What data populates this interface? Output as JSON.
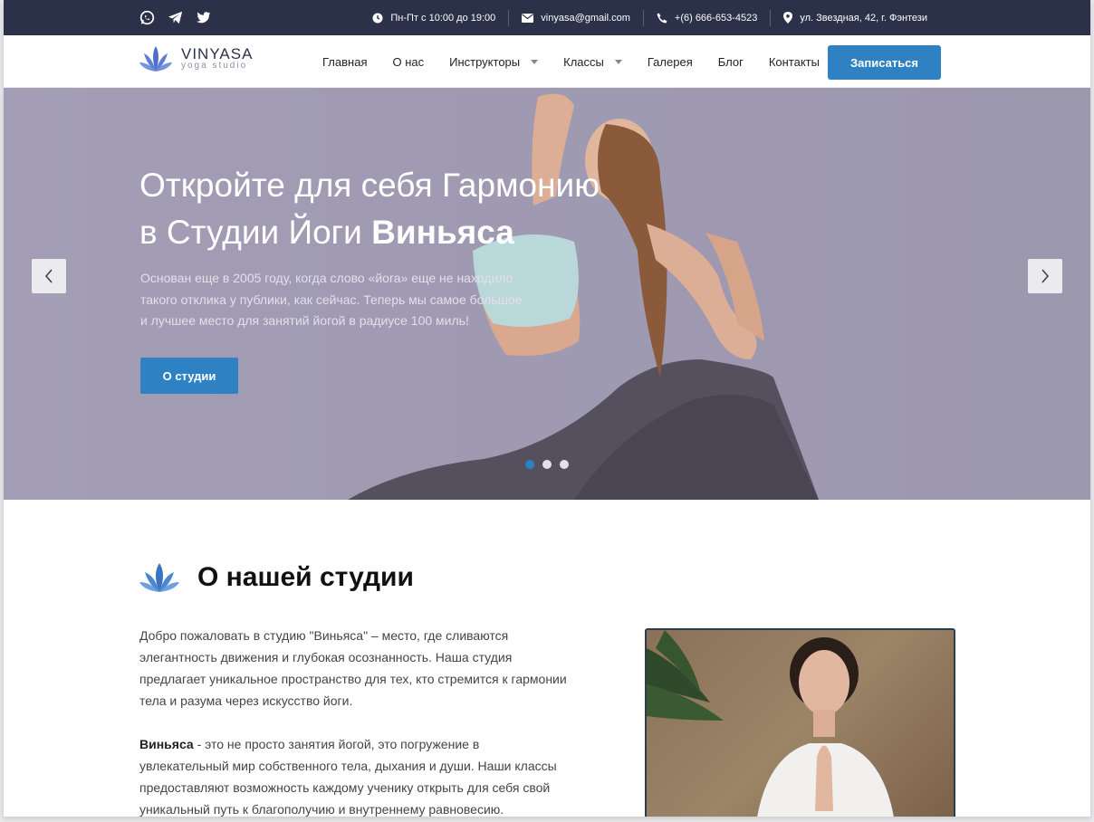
{
  "topbar": {
    "hours": "Пн-Пт с 10:00 до 19:00",
    "email": "vinyasa@gmail.com",
    "phone": "+(6) 666-653-4523",
    "address": "ул. Звездная, 42, г. Фэнтези"
  },
  "header": {
    "logo_name": "VINYASA",
    "logo_sub": "yoga studio",
    "nav": [
      {
        "label": "Главная"
      },
      {
        "label": "О нас"
      },
      {
        "label": "Инструкторы"
      },
      {
        "label": "Классы"
      },
      {
        "label": "Галерея"
      },
      {
        "label": "Блог"
      },
      {
        "label": "Контакты"
      }
    ],
    "cta_label": "Записаться"
  },
  "hero": {
    "title_line1": "Откройте для себя Гармонию",
    "title_line2_prefix": "в Студии Йоги ",
    "title_line2_bold": "Виньяса",
    "description": "Основан еще в 2005 году, когда слово «йога» еще не находило такого отклика у публики, как сейчас. Теперь мы самое большое и лучшее место для занятий йогой в радиусе 100 миль!",
    "button_label": "О студии",
    "active_slide": 1,
    "slide_count": 3
  },
  "about": {
    "title": "О нашей студии",
    "paragraph1": "Добро пожаловать в студию \"Виньяса\" – место, где сливаются элегантность движения и глубокая осознанность. Наша студия предлагает уникальное пространство для тех, кто стремится к гармонии тела и разума через искусство йоги.",
    "paragraph2_bold": "Виньяса",
    "paragraph2_rest": " - это не просто занятия йогой, это погружение в увлекательный мир собственного тела, дыхания и души. Наши классы предоставляют возможность каждому ученику открыть для себя свой уникальный путь к благополучию и внутреннему равновесию."
  },
  "colors": {
    "accent": "#2e82c4",
    "topbar": "#2b3148",
    "hero_bg": "#a39eb5"
  }
}
